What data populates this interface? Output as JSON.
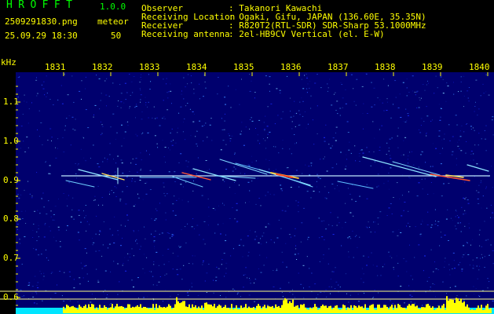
{
  "header": {
    "app_name": "HROFFT",
    "version": "1.0.0",
    "file_name": "2509291830.png",
    "datetime": "25.09.29 18:30",
    "type_label": "meteor",
    "count": "50"
  },
  "info": [
    {
      "label": "Observer",
      "value": ": Takanori Kawachi"
    },
    {
      "label": "Receiving Location",
      "value": ": Ogaki, Gifu, JAPAN (136.60E, 35.35N)"
    },
    {
      "label": "Receiver",
      "value": ": R820T2(RTL-SDR) SDR-Sharp 53.1000MHz"
    },
    {
      "label": "Receiving antenna",
      "value": ": 2el-HB9CV Vertical (el. E-W)"
    }
  ],
  "plot": {
    "y_unit": "kHz",
    "y_ticks": [
      "1.1",
      "1.0",
      "0.9",
      "0.8",
      "0.7",
      "0.6"
    ],
    "x_ticks": [
      "1831",
      "1832",
      "1833",
      "1834",
      "1835",
      "1836",
      "1837",
      "1838",
      "1839",
      "1840"
    ]
  },
  "colors": {
    "background": "#000000",
    "spectrogram": "#00006e",
    "label_yellow": "#ffff00",
    "title_green": "#00ff00",
    "carrier": "#bfeaff",
    "cyan_base": "#00e5ff"
  }
}
